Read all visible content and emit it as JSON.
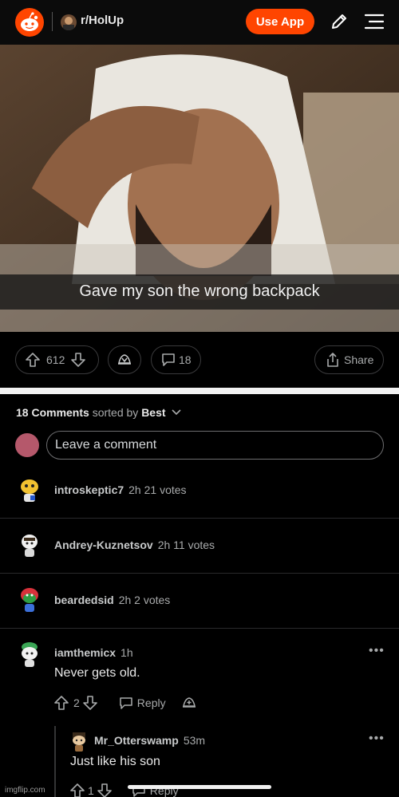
{
  "header": {
    "subreddit": "r/HolUp",
    "use_app_label": "Use App"
  },
  "post": {
    "image_caption": "Gave my son the wrong backpack",
    "score": "612",
    "comments_count": "18",
    "share_label": "Share"
  },
  "comments_header": {
    "count_label": "18 Comments",
    "sorted_by_label": "sorted by",
    "sort_value": "Best"
  },
  "comment_input": {
    "placeholder": "Leave a comment"
  },
  "collapsed_comments": [
    {
      "user": "introskeptic7",
      "meta": "2h  21 votes"
    },
    {
      "user": "Andrey-Kuznetsov",
      "meta": "2h  11 votes"
    },
    {
      "user": "beardedsid",
      "meta": "2h  2 votes"
    }
  ],
  "comments": [
    {
      "user": "iamthemicx",
      "time": "1h",
      "body": "Never gets old.",
      "score": "2",
      "reply_label": "Reply"
    },
    {
      "user": "Mr_Otterswamp",
      "time": "53m",
      "body": "Just like his son",
      "score": "1",
      "reply_label": "Reply"
    }
  ],
  "watermark": "imgflip.com",
  "colors": {
    "accent": "#ff4500",
    "background": "#000000"
  }
}
